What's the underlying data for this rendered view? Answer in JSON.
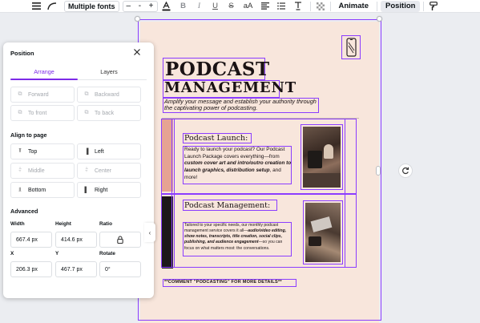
{
  "toolbar": {
    "font_family": "Multiple fonts",
    "font_size_minus": "–",
    "font_size_value": "-",
    "font_size_plus": "+",
    "bold": "B",
    "italic": "I",
    "underline": "U",
    "strikethrough": "S",
    "case": "aA",
    "animate": "Animate",
    "position": "Position"
  },
  "panel": {
    "title": "Position",
    "tabs": [
      {
        "label": "Arrange"
      },
      {
        "label": "Layers"
      }
    ],
    "arrange_buttons": [
      {
        "label": "Forward"
      },
      {
        "label": "Backward"
      },
      {
        "label": "To front"
      },
      {
        "label": "To back"
      }
    ],
    "align_title": "Align to page",
    "align_buttons": [
      {
        "label": "Top"
      },
      {
        "label": "Left"
      },
      {
        "label": "Middle"
      },
      {
        "label": "Center"
      },
      {
        "label": "Bottom"
      },
      {
        "label": "Right"
      }
    ],
    "advanced_title": "Advanced",
    "fields": {
      "width": {
        "label": "Width",
        "value": "667.4 px"
      },
      "height": {
        "label": "Height",
        "value": "414.6 px"
      },
      "ratio": {
        "label": "Ratio"
      },
      "x": {
        "label": "X",
        "value": "206.3 px"
      },
      "y": {
        "label": "Y",
        "value": "467.7 px"
      },
      "rotate": {
        "label": "Rotate",
        "value": "0°"
      }
    }
  },
  "design": {
    "title_line1": "PODCAST",
    "title_line2": "MANAGEMENT",
    "subtitle": "Amplify your message and establish your authority through the captivating power of podcasting.",
    "card1": {
      "heading": "Podcast Launch:",
      "body_plain": "Ready to launch your podcast? Our Podcast Launch Package covers everything—from ",
      "body_bold": "custom cover art and intro/outro creation to launch graphics, distribution setup",
      "body_end": ", and more!"
    },
    "card2": {
      "heading": "Podcast Management:",
      "body_plain": "Tailored to your specific needs, our monthly podcast management service covers it all—",
      "body_bold": "audio/video editing, show notes, transcripts, title creation, social clips, publishing, and audience engagement",
      "body_end": "—so you can focus on what matters most: the conversations."
    },
    "footer": "**COMMENT \"PODCASTING\" FOR MORE DETAILS**"
  },
  "colors": {
    "accent": "#8b3dff",
    "page_bg": "#f8e6dc",
    "stripe_pink": "#e6a393",
    "stripe_dark": "#1d1819"
  },
  "icons": [
    "menu-icon",
    "curve-icon",
    "text-color-icon",
    "align-icon",
    "list-icon",
    "spacing-icon",
    "transparency-icon",
    "paint-roller-icon",
    "close-icon",
    "lock-icon",
    "rotate-icon",
    "phone-icon",
    "chevron-left-icon"
  ]
}
